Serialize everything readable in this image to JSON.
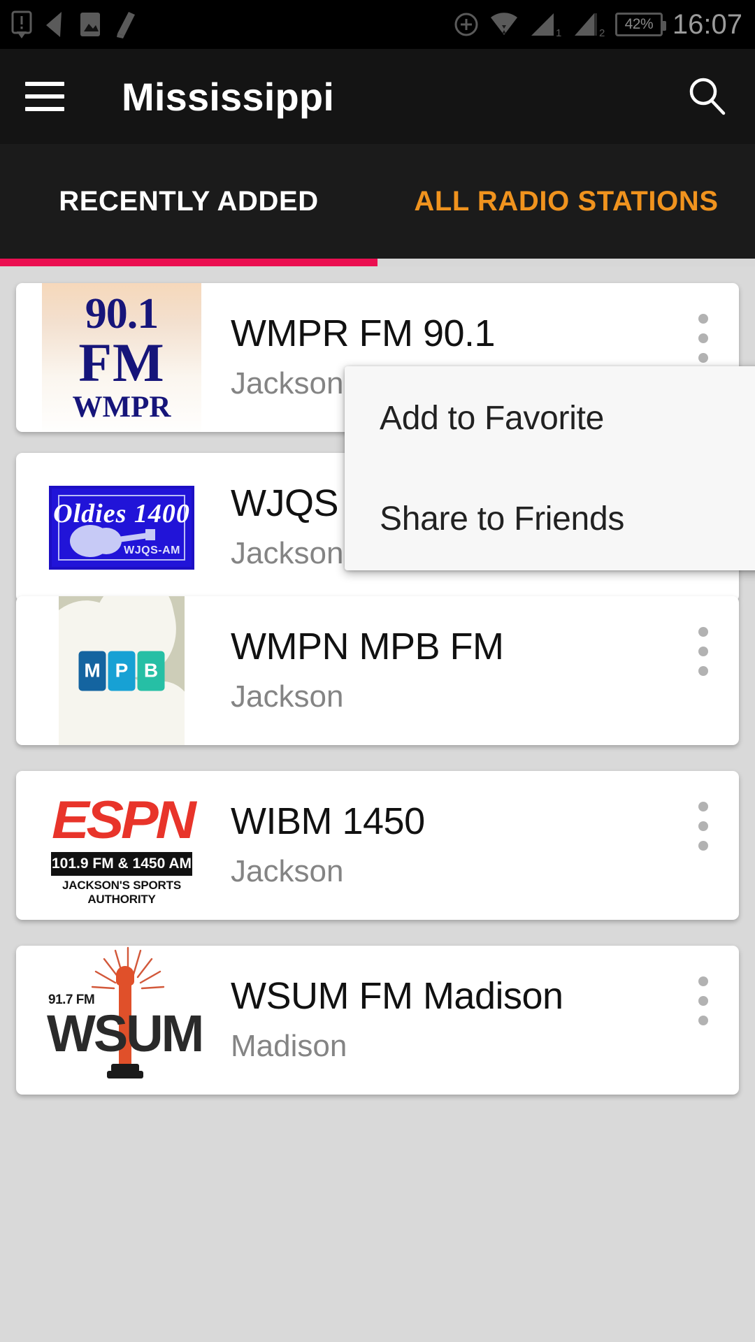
{
  "status_bar": {
    "icons_left": [
      "sim-alert-icon",
      "back-arrow-icon",
      "image-icon",
      "broom-clean-icon"
    ],
    "icons_right": [
      "sync-icon",
      "wifi-icon",
      "signal-1-icon",
      "signal-2-icon"
    ],
    "signal_1_label": "1",
    "signal_2_label": "2",
    "battery_percent": "42%",
    "time": "16:07"
  },
  "app_bar": {
    "menu_icon": "hamburger-menu-icon",
    "title": "Mississippi",
    "search_icon": "search-icon"
  },
  "tabs": {
    "active_index": 0,
    "indicator_color": "#EB0F51",
    "items": [
      {
        "label": "RECENTLY ADDED",
        "color": "#FFFFFF"
      },
      {
        "label": "ALL RADIO STATIONS",
        "color": "#F0931E"
      }
    ]
  },
  "stations": [
    {
      "name": "WMPR FM 90.1",
      "city": "Jackson",
      "logo": "wmpr-logo",
      "logo_text": {
        "line1": "90.1",
        "line2": "FM",
        "line3": "WMPR"
      },
      "overflow_icon": "more-vertical-icon"
    },
    {
      "name": "WJQS Oldies AM",
      "city": "Jackson",
      "logo": "wjqs-oldies-1400-logo",
      "logo_text": {
        "title": "Oldies 1400",
        "call": "WJQS-AM"
      },
      "overflow_icon": "more-vertical-icon"
    },
    {
      "name": "WMPN MPB FM",
      "city": "Jackson",
      "logo": "mpb-logo",
      "logo_text": {
        "t1": "M",
        "t2": "P",
        "t3": "B"
      },
      "logo_colors": [
        "#1464a0",
        "#17a1d4",
        "#26bfa5"
      ],
      "overflow_icon": "more-vertical-icon"
    },
    {
      "name": "WIBM 1450",
      "city": "Jackson",
      "logo": "espn-radio-logo",
      "logo_text": {
        "word": "ESPN",
        "bar": "101.9 FM & 1450 AM",
        "tagline": "JACKSON'S SPORTS AUTHORITY"
      },
      "overflow_icon": "more-vertical-icon"
    },
    {
      "name": "WSUM FM Madison",
      "city": "Madison",
      "logo": "wsum-logo",
      "logo_text": {
        "freq": "91.7 FM",
        "letters": "WSUM"
      },
      "overflow_icon": "more-vertical-icon"
    }
  ],
  "context_menu": {
    "items": [
      {
        "label": "Add to Favorite"
      },
      {
        "label": "Share to Friends"
      }
    ]
  }
}
